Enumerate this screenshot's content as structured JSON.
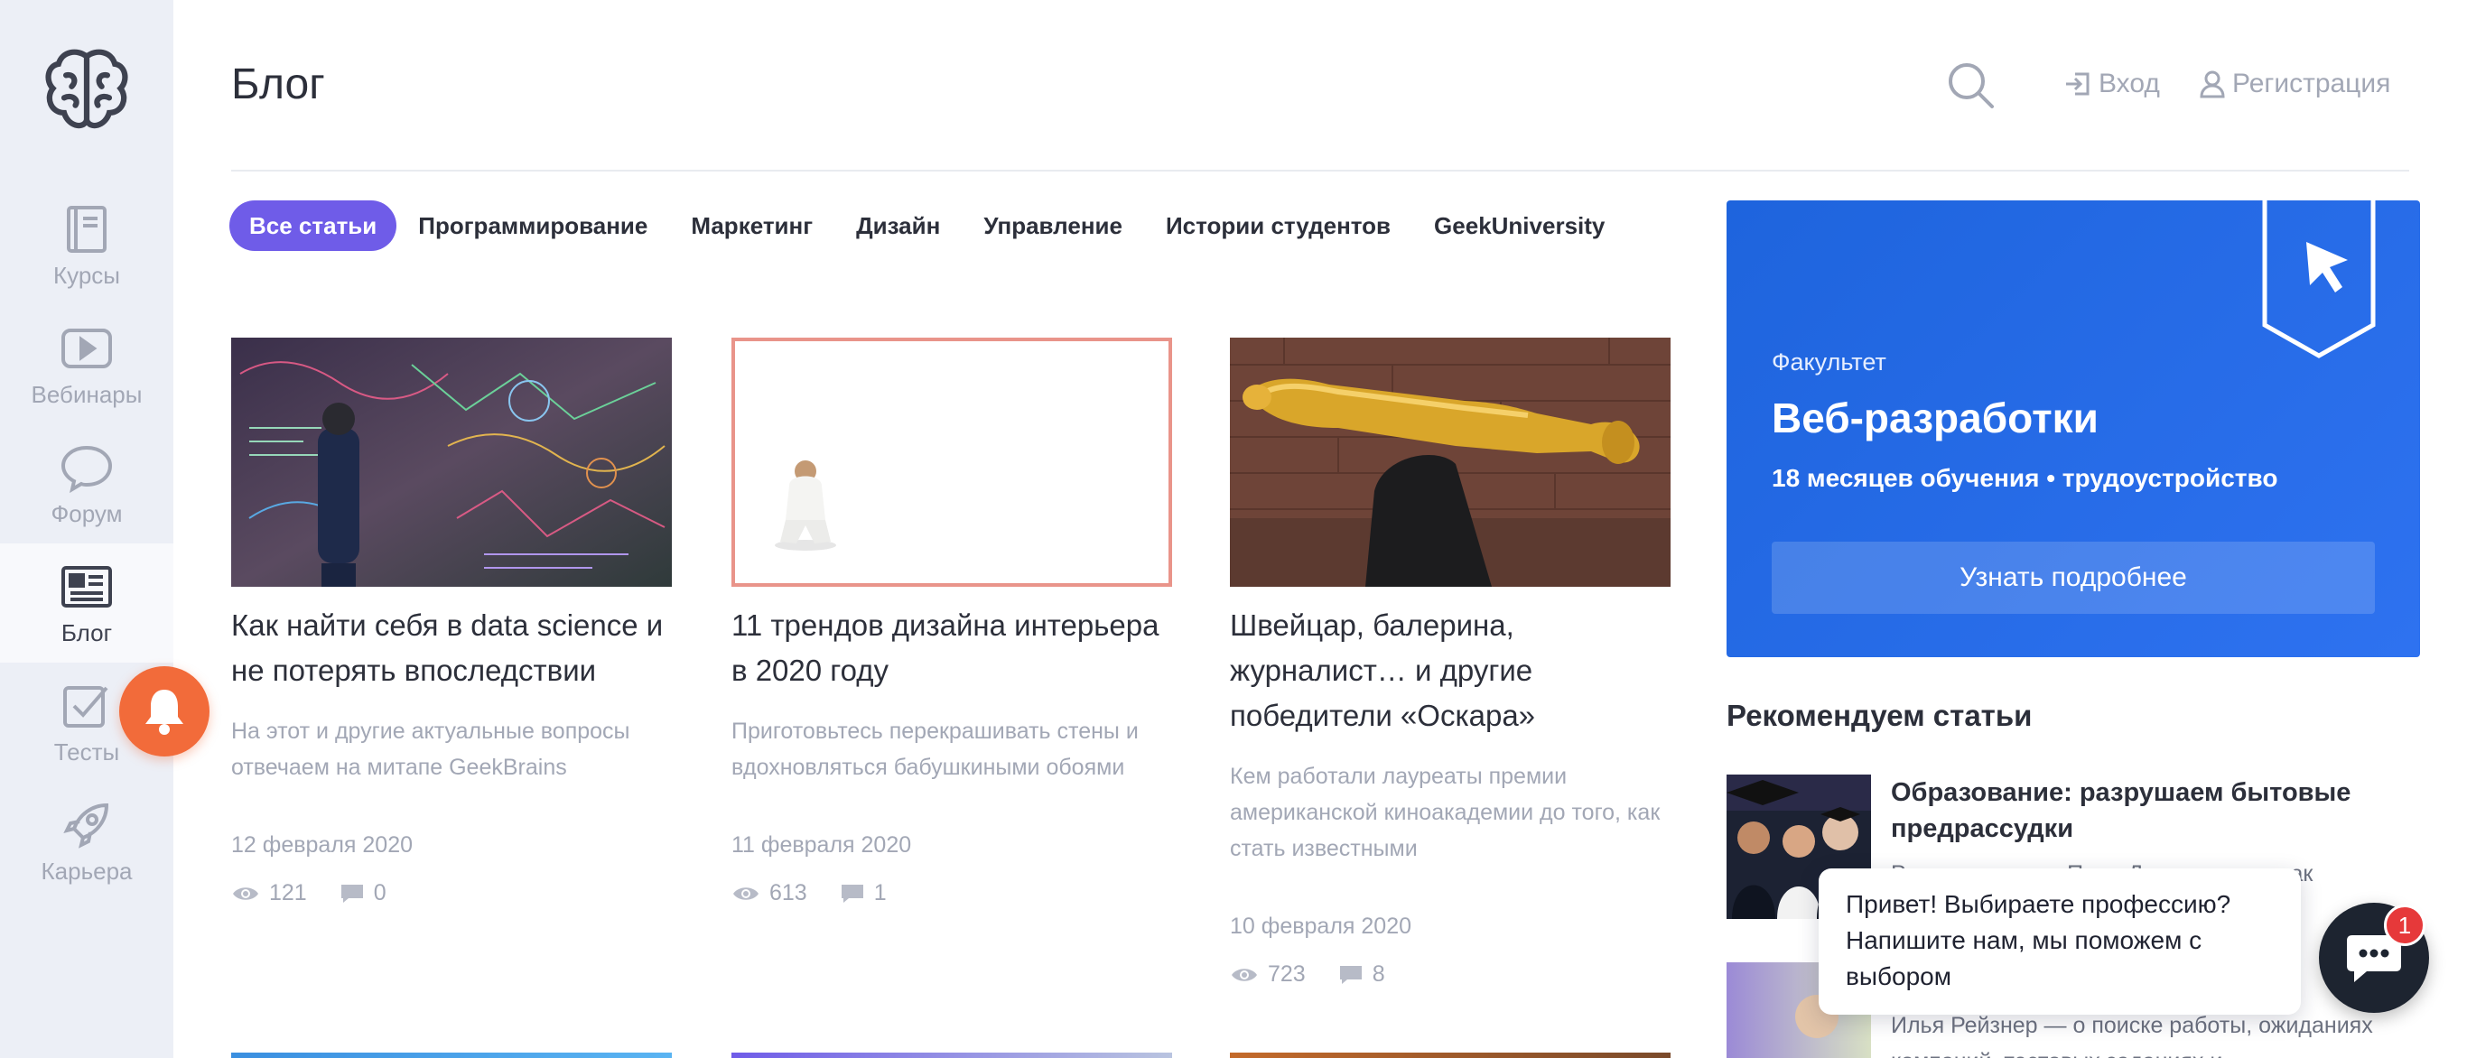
{
  "sidebar": {
    "items": [
      {
        "label": "Курсы",
        "icon": "book-icon"
      },
      {
        "label": "Вебинары",
        "icon": "play-icon"
      },
      {
        "label": "Форум",
        "icon": "chat-icon"
      },
      {
        "label": "Блог",
        "icon": "newspaper-icon",
        "active": true
      },
      {
        "label": "Тесты",
        "icon": "checkbox-icon"
      },
      {
        "label": "Карьера",
        "icon": "rocket-icon"
      }
    ]
  },
  "header": {
    "title": "Блог",
    "login_label": "Вход",
    "register_label": "Регистрация"
  },
  "tabs": [
    {
      "label": "Все статьи",
      "active": true
    },
    {
      "label": "Программирование"
    },
    {
      "label": "Маркетинг"
    },
    {
      "label": "Дизайн"
    },
    {
      "label": "Управление"
    },
    {
      "label": "Истории студентов"
    },
    {
      "label": "GeekUniversity"
    }
  ],
  "articles": [
    {
      "title": "Как найти себя в data science и не потерять впоследствии",
      "description": "На этот и другие актуальные вопросы отвечаем на митапе GeekBrains",
      "date": "12 февраля 2020",
      "views": "121",
      "comments": "0"
    },
    {
      "title": "11 трендов дизайна интерьера в 2020 году",
      "description": "Приготовьтесь перекрашивать стены и вдохновляться бабушкиными обоями",
      "date": "11 февраля 2020",
      "views": "613",
      "comments": "1"
    },
    {
      "title": "Швейцар, балерина, журналист… и другие победители «Оскара»",
      "description": "Кем работали лауреаты премии американской киноакадемии до того, как стать известными",
      "date": "10 февраля 2020",
      "views": "723",
      "comments": "8"
    }
  ],
  "promo": {
    "label": "Факультет",
    "title": "Веб-разработки",
    "subtitle": "18 месяцев обучения • трудоустройство",
    "button": "Узнать подробнее"
  },
  "recommended": {
    "title": "Рекомендуем статьи",
    "items": [
      {
        "title": "Образование: разрушаем бытовые предрассудки",
        "excerpt": "Рассказываем о Пали Деванш… ем, как"
      },
      {
        "title": "",
        "excerpt": "Илья Рейзнер — о поиске работы, ожиданиях компаний, тестовых заданиях и"
      }
    ]
  },
  "chat": {
    "message": "Привет! Выбираете профессию? Напишите нам, мы поможем с выбором",
    "badge": "1"
  },
  "colors": {
    "accent": "#6f5ce8",
    "promo_blue": "#1e64dd",
    "notify_orange": "#f26b3a",
    "sidebar_bg": "#eceff6"
  }
}
